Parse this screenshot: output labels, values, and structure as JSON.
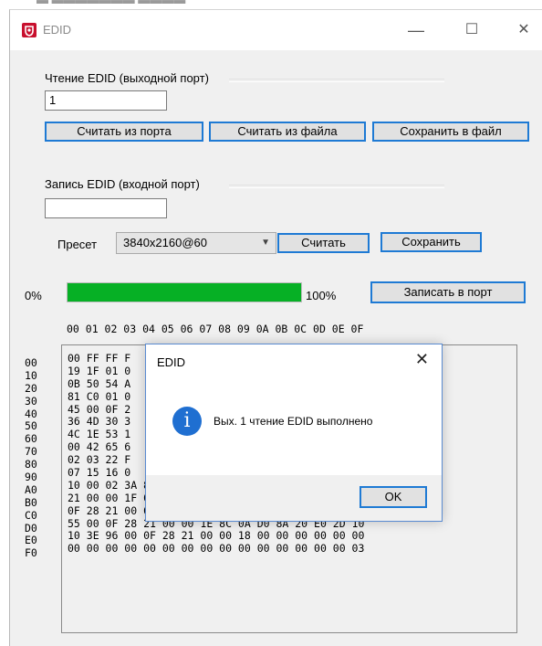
{
  "window": {
    "title": "EDID",
    "controls": {
      "minimize": "—",
      "maximize": "☐",
      "close": "✕"
    }
  },
  "read_section": {
    "label": "Чтение EDID (выходной порт)",
    "port_value": "1",
    "buttons": {
      "read_port": "Считать из порта",
      "read_file": "Считать из файла",
      "save_file": "Сохранить в файл"
    }
  },
  "write_section": {
    "label": "Запись EDID (входной порт)",
    "port_value": "",
    "preset_label": "Пресет",
    "preset_value": "3840x2160@60",
    "buttons": {
      "read": "Считать",
      "save": "Сохранить",
      "write_port": "Записать в порт"
    }
  },
  "progress": {
    "start_label": "0%",
    "end_label": "100%",
    "value_percent": 100,
    "color": "#06b025"
  },
  "hex": {
    "header": "00 01 02 03 04 05 06 07 08 09 0A 0B 0C 0D 0E 0F",
    "row_labels": [
      "00",
      "10",
      "20",
      "30",
      "40",
      "50",
      "60",
      "70",
      "80",
      "90",
      "A0",
      "B0",
      "C0",
      "D0",
      "E0",
      "F0"
    ],
    "rows": [
      "00 FF FF F",
      "19 1F 01 0",
      "0B 50 54 A",
      "81 C0 01 0",
      "45 00 0F 2",
      "36 4D 30 3",
      "4C 1E 53 1",
      "00 42 65 6",
      "02 03 22 F",
      "07 15 16 0",
      "10 00 02 3A 80 18 71 38 2D 40 58 2C 45 00 0F 28",
      "21 00 00 1F 01 1D 80 18 71 1C 16 20 58 2C 25 00",
      "0F 28 21 00 00 9F 01 1D 00 72 51 D0 1E 20 6E 28",
      "55 00 0F 28 21 00 00 1E 8C 0A D0 8A 20 E0 2D 10",
      "10 3E 96 00 0F 28 21 00 00 18 00 00 00 00 00 00",
      "00 00 00 00 00 00 00 00 00 00 00 00 00 00 00 03"
    ]
  },
  "dialog": {
    "title": "EDID",
    "message": "Вых. 1 чтение EDID выполнено",
    "ok": "OK",
    "icon": "info-icon",
    "close": "✕"
  }
}
